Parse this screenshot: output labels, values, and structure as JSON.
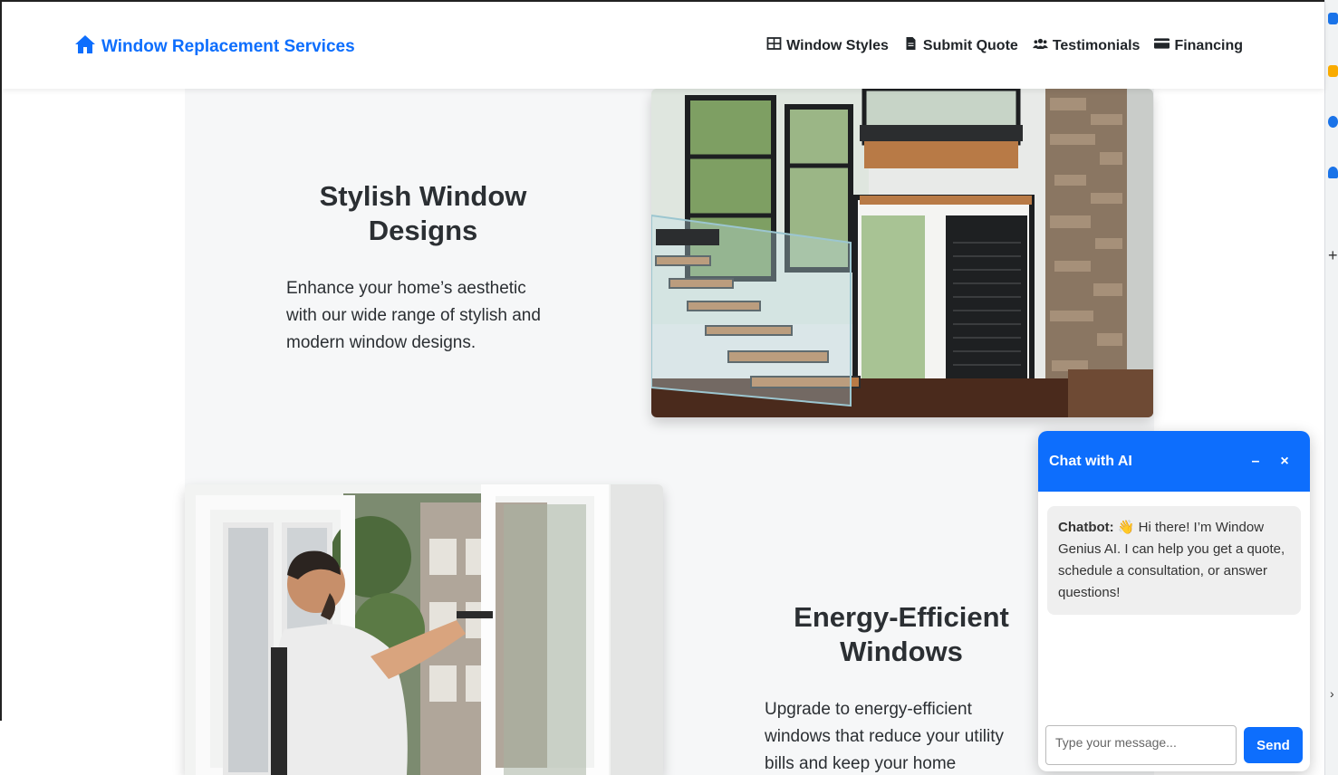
{
  "header": {
    "brand": "Window Replacement Services",
    "nav": [
      {
        "label": "Window Styles",
        "icon": "grid-icon"
      },
      {
        "label": "Submit Quote",
        "icon": "document-icon"
      },
      {
        "label": "Testimonials",
        "icon": "users-icon"
      },
      {
        "label": "Financing",
        "icon": "credit-card-icon"
      }
    ]
  },
  "features": [
    {
      "title": "Stylish Window Designs",
      "text": "Enhance your home’s aesthetic with our wide range of stylish and modern window designs."
    },
    {
      "title": "Energy-Efficient Windows",
      "text": "Upgrade to energy-efficient windows that reduce your utility bills and keep your home"
    }
  ],
  "chat": {
    "title": "Chat with AI",
    "minimize": "–",
    "close": "×",
    "sender": "Chatbot:",
    "message": "👋 Hi there! I’m Window Genius AI. I can help you get a quote, schedule a consultation, or answer questions!",
    "placeholder": "Type your message...",
    "send": "Send"
  },
  "colors": {
    "accent": "#0d6efd",
    "section_bg": "#f6f7f8",
    "bubble_bg": "#efefef"
  }
}
